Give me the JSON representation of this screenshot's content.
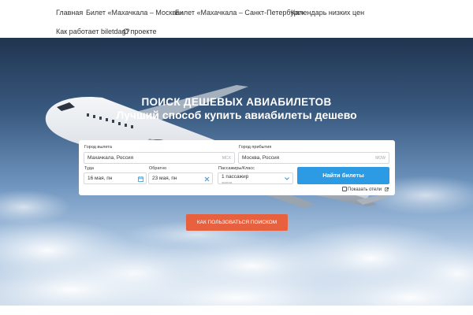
{
  "nav": {
    "items": [
      {
        "label": "Главная"
      },
      {
        "label": "Билет «Махачкала – Москва»"
      },
      {
        "label": "Билет «Махачкала – Санкт-Петербург»"
      },
      {
        "label": "Календарь низких цен"
      },
      {
        "label": "Как работает biletdag?"
      },
      {
        "label": "О проекте"
      }
    ]
  },
  "hero": {
    "title": "ПОИСК ДЕШЕВЫХ АВИАБИЛЕТОВ",
    "subtitle": "Лучший способ купить авиабилеты дешево"
  },
  "search": {
    "origin_label": "Город вылета",
    "origin_value": "Махачкала, Россия",
    "origin_code": "MCX",
    "destination_label": "Город прибытия",
    "destination_value": "Москва, Россия",
    "destination_code": "MOW",
    "depart_label": "Туда",
    "depart_value": "16 мая, пн",
    "return_label": "Обратно",
    "return_value": "23 мая, пн",
    "passengers_label": "Пассажиры/Класс",
    "passengers_value": "1 пассажир",
    "class_value": "эконом",
    "submit_label": "Найти билеты",
    "show_hotels_label": "Показать отели"
  },
  "howto_button": "КАК ПОЛЬЗОВАТЬСЯ ПОИСКОМ",
  "colors": {
    "search_button": "#2d9be3",
    "howto_button": "#e8613f",
    "calendar_icon": "#2d9be3"
  },
  "icons": [
    "calendar-icon",
    "close-icon",
    "chevron-down-icon",
    "checkbox-icon",
    "link-icon",
    "airplane-image"
  ]
}
